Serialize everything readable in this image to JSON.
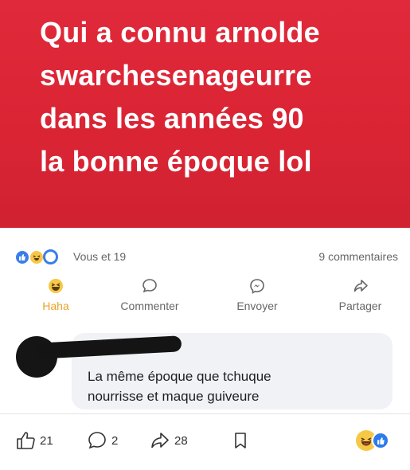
{
  "banner": {
    "text": "Qui a connu arnolde\nswarchesenageurre\ndans les années 90\nla bonne époque lol",
    "background_color": "#da2434"
  },
  "reactions": {
    "icons": [
      "like-icon",
      "haha-icon",
      "love-icon"
    ],
    "summary": "Vous et 19",
    "comments_count": "9 commentaires"
  },
  "actions": [
    {
      "label": "Haha",
      "icon": "haha-icon"
    },
    {
      "label": "Commenter",
      "icon": "comment-icon"
    },
    {
      "label": "Envoyer",
      "icon": "messenger-icon"
    },
    {
      "label": "Partager",
      "icon": "share-icon"
    }
  ],
  "comment": {
    "text": "La même époque que tchuque\nnourrisse et maque guiveure"
  },
  "bottom_bar": {
    "likes": "21",
    "comments": "2",
    "shares": "28",
    "reactions": [
      "haha-icon",
      "like-icon"
    ]
  },
  "colors": {
    "accent_blue": "#3a7ee9",
    "haha_yellow": "#f7c846",
    "haha_label": "#e8a32b"
  }
}
